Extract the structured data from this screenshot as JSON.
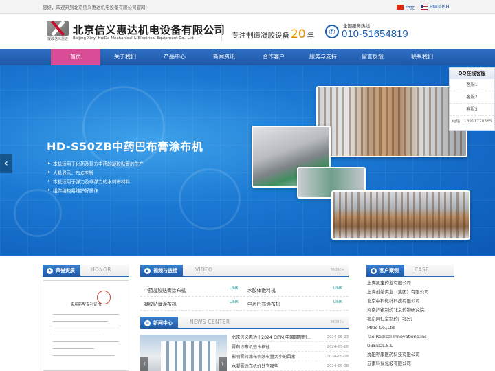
{
  "topbar": {
    "welcome": "您好，欢迎来到北京信义惠达机电设备有限公司官网!",
    "lang_cn": "中文",
    "lang_en": "ENGLISH"
  },
  "header": {
    "logo_caption": "凝胶信义惠达",
    "company_cn": "北京信义惠达机电设备有限公司",
    "company_en": "Beijing Xinyi HuiDa Mechanical & Electrical Equipment Co., Ltd",
    "slogan_pre": "专注制造凝胶设备",
    "slogan_num": "20",
    "slogan_post": "年",
    "hotline_label": "全国服务热线：",
    "hotline": "010-51654819"
  },
  "nav": {
    "items": [
      "首页",
      "关于我们",
      "产品中心",
      "新闻资讯",
      "合作客户",
      "服务与支持",
      "留言反馈",
      "联系我们"
    ],
    "active": 0
  },
  "banner": {
    "title": "HD-S50ZB中药巴布膏涂布机",
    "features": [
      "本机适用于化药及复方中药的凝胶贴膏的生产",
      "人机显示、PLC控制",
      "本机适用于弹力及非弹力的水刺布材料",
      "组件结构易维护好操作"
    ],
    "slides": 6,
    "active_slide": 1,
    "prev_arrow": "‹"
  },
  "qq": {
    "title": "QQ在线客服",
    "items": [
      "客服1",
      "客服2",
      "客服3"
    ],
    "phone": "电话：13911770565"
  },
  "honor": {
    "title": "荣誉资质",
    "en": "HONOR",
    "cert_title": "实用新型专利证书"
  },
  "video": {
    "title": "视频与链接",
    "en": "VIDEO",
    "more": "MORE+",
    "link_label": "LINK",
    "items": [
      "中药凝胶贴膏涂布机",
      "水胶体敷料机",
      "凝胶贴膏涂布机",
      "中药巴布涂布机"
    ]
  },
  "news": {
    "title": "新闻中心",
    "en": "NEWS CENTER",
    "more": "MORE+",
    "items": [
      {
        "title": "北京信义惠达 | 2024 CIPM 中国国际制...",
        "date": "2024-05-23"
      },
      {
        "title": "膏药涂布机基本概述",
        "date": "2024-05-10"
      },
      {
        "title": "影响膏药涂布机涂布量大小的因素",
        "date": "2024-05-09"
      },
      {
        "title": "水凝膏涂布机好处有哪些",
        "date": "2024-05-08"
      }
    ]
  },
  "customers": {
    "title": "客户案例",
    "en": "CASE",
    "items": [
      "上海凯宝药业有限公司",
      "上海创始实业（集团）有限公司",
      "北京中科微针科技有限公司",
      "河南羚锐制药北京药物研究院",
      "北京同仁堂制药厂北分厂",
      "Mitio Co.,Ltd",
      "Tao Radical Innovations,Inc",
      "UBESOL.S.L",
      "沈阳得康医药科技有限公司",
      "云南科仪化坡有限公司"
    ]
  },
  "colors": {
    "nav": "#1e58a8",
    "nav_active": "#d94c96",
    "accent": "#1a5fb4",
    "orange": "#f08a00"
  }
}
